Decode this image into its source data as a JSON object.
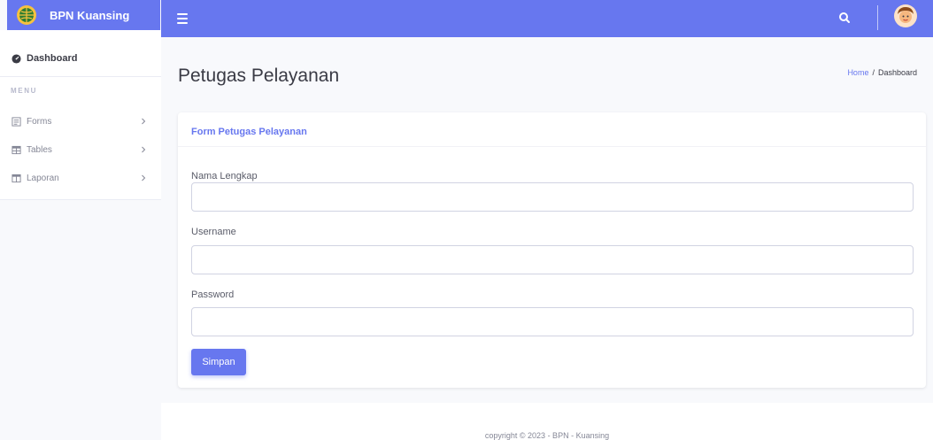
{
  "brand": {
    "name": "BPN Kuansing",
    "logo_icon": "globe-emblem-icon"
  },
  "topbar": {
    "menu_icon": "bars-icon",
    "search_icon": "search-icon",
    "avatar_icon": "user-avatar-icon"
  },
  "sidebar": {
    "dashboard_label": "Dashboard",
    "heading": "MENU",
    "items": [
      {
        "label": "Forms",
        "icon": "form-icon"
      },
      {
        "label": "Tables",
        "icon": "table-icon"
      },
      {
        "label": "Laporan",
        "icon": "columns-icon"
      }
    ]
  },
  "page": {
    "title": "Petugas Pelayanan",
    "breadcrumb": {
      "home": "Home",
      "separator": "/",
      "current": "Dashboard"
    }
  },
  "form": {
    "title": "Form Petugas Pelayanan",
    "fields": [
      {
        "label": "Nama Lengkap",
        "value": "",
        "placeholder": ""
      },
      {
        "label": "Username",
        "value": "",
        "placeholder": ""
      },
      {
        "label": "Password",
        "value": "",
        "placeholder": ""
      }
    ],
    "submit_label": "Simpan"
  },
  "footer": {
    "text": "copyright © 2023 - BPN - Kuansing"
  },
  "colors": {
    "primary": "#6777ef",
    "background": "#f8f9fc",
    "text": "#5a5c69"
  }
}
